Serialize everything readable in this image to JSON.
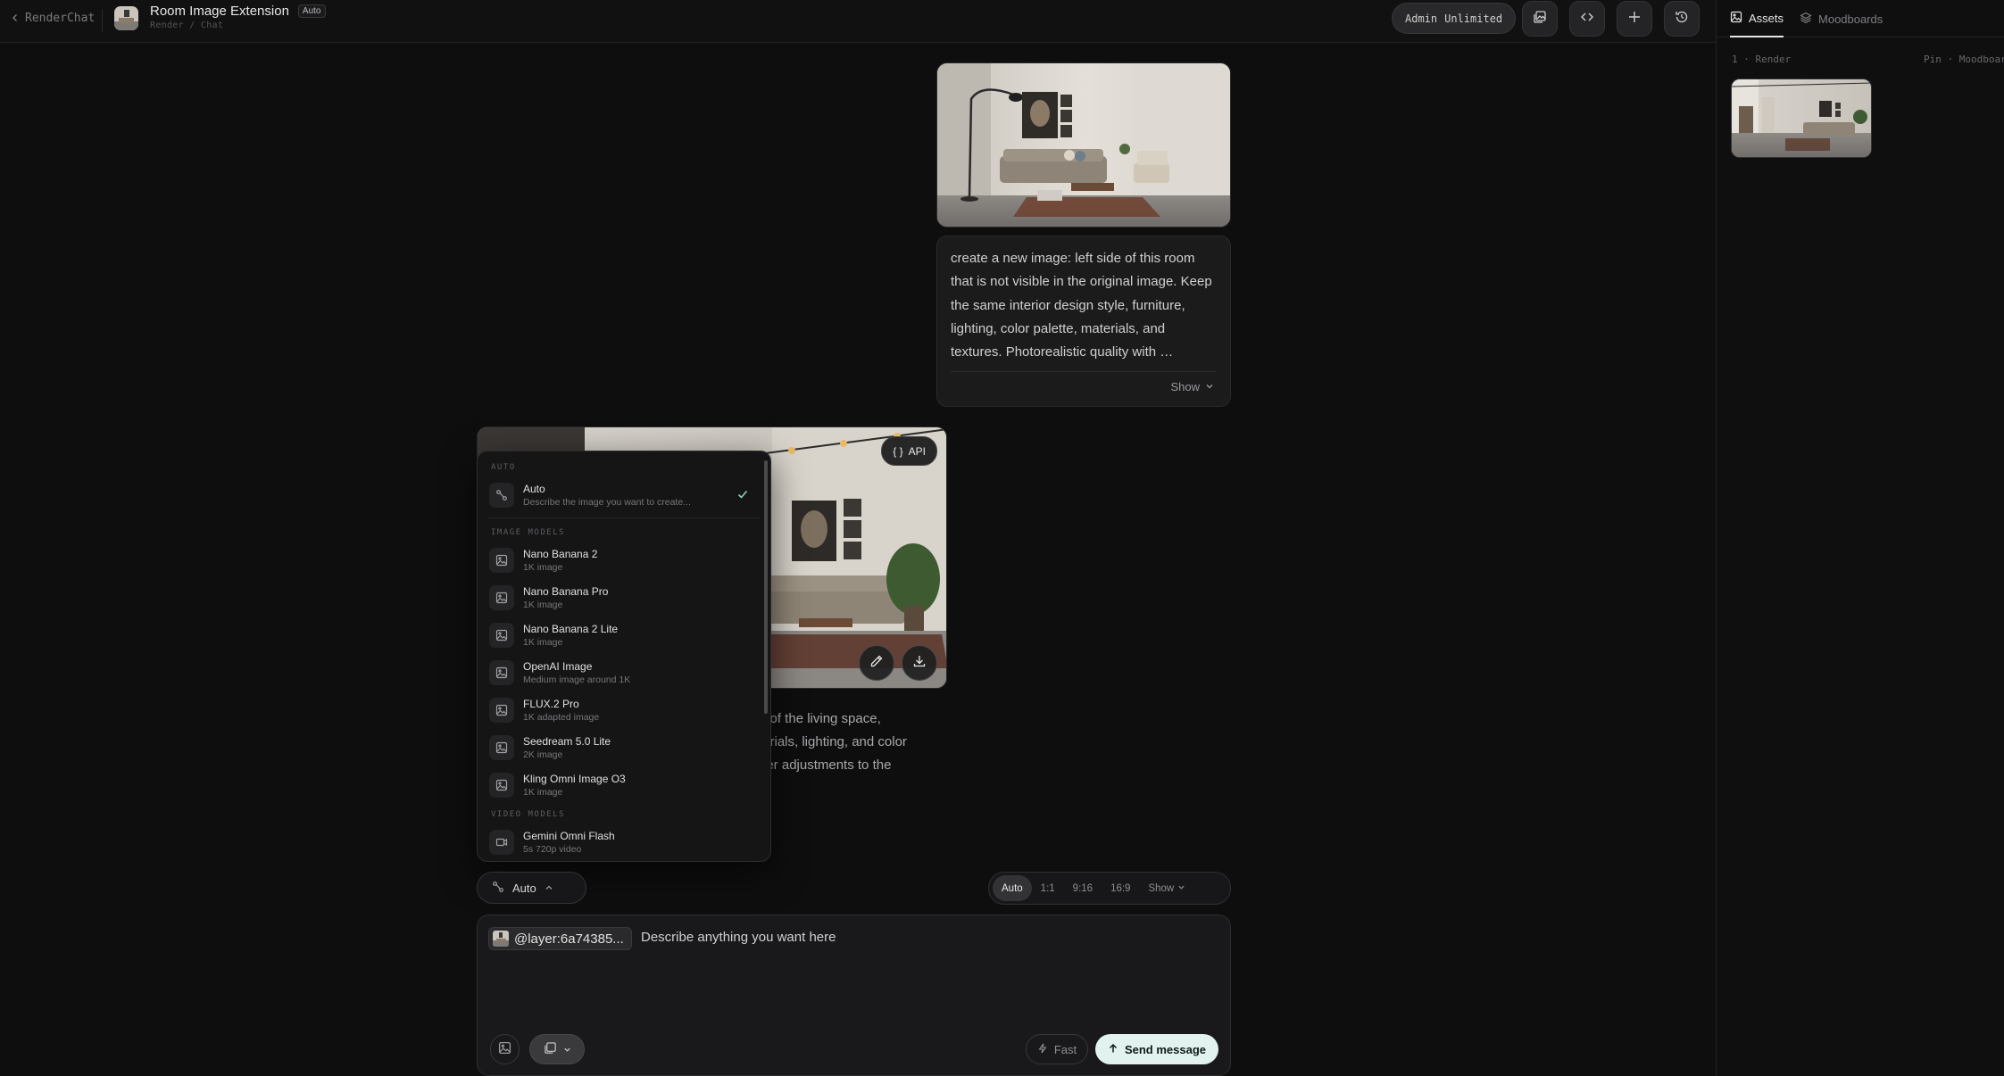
{
  "header": {
    "back_label": "RenderChat",
    "title": "Room Image Extension",
    "title_badge": "Auto",
    "breadcrumb": "Render / Chat",
    "plan_label": "Admin",
    "plan_value": "Unlimited"
  },
  "right_panel": {
    "tabs": [
      {
        "label": "Assets",
        "icon": "image-icon",
        "active": true
      },
      {
        "label": "Moodboards",
        "icon": "layers-icon",
        "active": false
      }
    ],
    "left_meta": "1 · Render",
    "right_meta": "Pin · Moodboard"
  },
  "user_message": {
    "text": "create a new image: left side of this room that is not visible in the original image. Keep the same interior design style, furniture, lighting, color palette, materials, and textures. Photorealistic quality with …",
    "show_label": "Show"
  },
  "response": {
    "api_label": "API",
    "text_fragment_1": "e of the living space,",
    "text_fragment_2": "terials, lighting, and color",
    "text_fragment_3": "her adjustments to the"
  },
  "model_menu": {
    "auto_heading": "AUTO",
    "auto_item": {
      "name": "Auto",
      "desc": "Describe the image you want to create...",
      "selected": true
    },
    "image_heading": "IMAGE MODELS",
    "image_models": [
      {
        "name": "Nano Banana 2",
        "desc": "1K image"
      },
      {
        "name": "Nano Banana Pro",
        "desc": "1K image"
      },
      {
        "name": "Nano Banana 2 Lite",
        "desc": "1K image"
      },
      {
        "name": "OpenAI Image",
        "desc": "Medium image around 1K"
      },
      {
        "name": "FLUX.2 Pro",
        "desc": "1K adapted image"
      },
      {
        "name": "Seedream 5.0 Lite",
        "desc": "2K image"
      },
      {
        "name": "Kling Omni Image O3",
        "desc": "1K image"
      }
    ],
    "video_heading": "VIDEO MODELS",
    "video_models": [
      {
        "name": "Gemini Omni Flash",
        "desc": "5s 720p video"
      }
    ]
  },
  "model_selector": {
    "label": "Auto"
  },
  "aspect_ratios": {
    "options": [
      "Auto",
      "1:1",
      "9:16",
      "16:9"
    ],
    "active": "Auto",
    "more_label": "Show"
  },
  "composer": {
    "chip_label": "@layer:6a74385...",
    "placeholder": "Describe anything you want here",
    "fast_label": "Fast",
    "send_label": "Send message"
  },
  "colors": {
    "background": "#0e0e0f",
    "panel": "#19191b",
    "send_button": "#e2f2ee",
    "check": "#8fd3b8"
  }
}
